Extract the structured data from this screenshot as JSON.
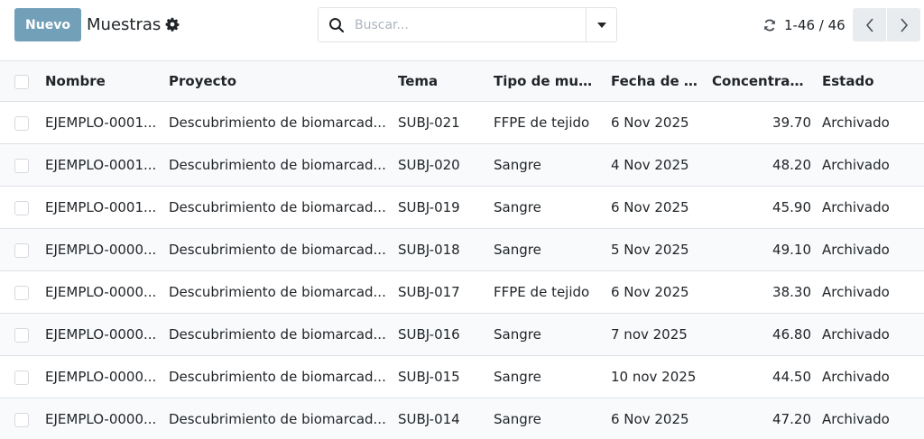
{
  "control_panel": {
    "new_button": "Nuevo",
    "title": "Muestras",
    "search_placeholder": "Buscar...",
    "pager_value": "1-46 / 46"
  },
  "table": {
    "columns": [
      "Nombre",
      "Proyecto",
      "Tema",
      "Tipo de mues...",
      "Fecha de re...",
      "Concentraci...",
      "Estado"
    ],
    "rows": [
      {
        "nombre": "EJEMPLO-0001...",
        "proyecto": "Descubrimiento de biomarcad...",
        "tema": "SUBJ-021",
        "tipo": "FFPE de tejido",
        "fecha": "6 Nov 2025",
        "conc": "39.70",
        "estado": "Archivado"
      },
      {
        "nombre": "EJEMPLO-0001...",
        "proyecto": "Descubrimiento de biomarcad...",
        "tema": "SUBJ-020",
        "tipo": "Sangre",
        "fecha": "4 Nov 2025",
        "conc": "48.20",
        "estado": "Archivado"
      },
      {
        "nombre": "EJEMPLO-0001...",
        "proyecto": "Descubrimiento de biomarcad...",
        "tema": "SUBJ-019",
        "tipo": "Sangre",
        "fecha": "6 Nov 2025",
        "conc": "45.90",
        "estado": "Archivado"
      },
      {
        "nombre": "EJEMPLO-0000...",
        "proyecto": "Descubrimiento de biomarcad...",
        "tema": "SUBJ-018",
        "tipo": "Sangre",
        "fecha": "5 Nov 2025",
        "conc": "49.10",
        "estado": "Archivado"
      },
      {
        "nombre": "EJEMPLO-0000...",
        "proyecto": "Descubrimiento de biomarcad...",
        "tema": "SUBJ-017",
        "tipo": "FFPE de tejido",
        "fecha": "6 Nov 2025",
        "conc": "38.30",
        "estado": "Archivado"
      },
      {
        "nombre": "EJEMPLO-0000...",
        "proyecto": "Descubrimiento de biomarcad...",
        "tema": "SUBJ-016",
        "tipo": "Sangre",
        "fecha": "7 nov 2025",
        "conc": "46.80",
        "estado": "Archivado"
      },
      {
        "nombre": "EJEMPLO-0000...",
        "proyecto": "Descubrimiento de biomarcad...",
        "tema": "SUBJ-015",
        "tipo": "Sangre",
        "fecha": "10 nov 2025",
        "conc": "44.50",
        "estado": "Archivado"
      },
      {
        "nombre": "EJEMPLO-0000...",
        "proyecto": "Descubrimiento de biomarcad...",
        "tema": "SUBJ-014",
        "tipo": "Sangre",
        "fecha": "6 Nov 2025",
        "conc": "47.20",
        "estado": "Archivado"
      }
    ]
  }
}
